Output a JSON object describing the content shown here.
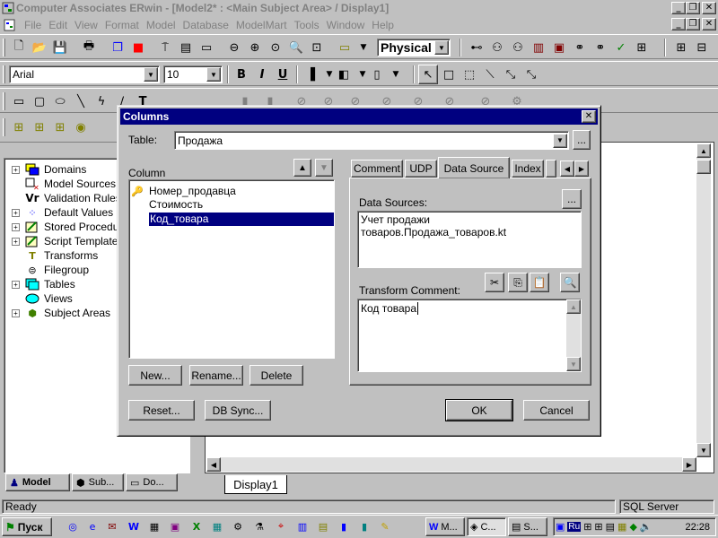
{
  "app": {
    "title": "Computer Associates ERwin - [Model2* : <Main Subject Area> / Display1]",
    "window_buttons": [
      "_",
      "❐",
      "✕"
    ],
    "child_buttons": [
      "_",
      "❐",
      "✕"
    ]
  },
  "menu": [
    "File",
    "Edit",
    "View",
    "Format",
    "Model",
    "Database",
    "ModelMart",
    "Tools",
    "Window",
    "Help"
  ],
  "toolbar": {
    "model_view": "Physical",
    "font_name": "Arial",
    "font_size": "10",
    "bold": "B",
    "italic": "I",
    "underline": "U"
  },
  "tree": [
    {
      "label": "Domains",
      "icon": "domains-icon"
    },
    {
      "label": "Model Sources",
      "icon": "model-sources-icon"
    },
    {
      "label": "Validation Rules",
      "icon": "validation-rules-icon"
    },
    {
      "label": "Default Values",
      "icon": "default-values-icon"
    },
    {
      "label": "Stored Procedures",
      "icon": "stored-procedures-icon"
    },
    {
      "label": "Script Templates",
      "icon": "script-templates-icon"
    },
    {
      "label": "Transforms",
      "icon": "transforms-icon"
    },
    {
      "label": "Filegroup",
      "icon": "filegroup-icon"
    },
    {
      "label": "Tables",
      "icon": "tables-icon"
    },
    {
      "label": "Views",
      "icon": "views-icon"
    },
    {
      "label": "Subject Areas",
      "icon": "subject-areas-icon"
    }
  ],
  "bottom_tabs": [
    "Model",
    "Sub...",
    "Do..."
  ],
  "display_tab": "Display1",
  "dialog": {
    "title": "Columns",
    "table_label": "Table:",
    "table_value": "Продажа",
    "ellipsis": "...",
    "column_label": "Column",
    "columns": [
      "Номер_продавца",
      "Стоимость",
      "Код_товара"
    ],
    "selected_index": 2,
    "tabs": [
      "Comment",
      "UDP",
      "Data Source",
      "Index"
    ],
    "active_tab": "Data Source",
    "data_sources_label": "Data Sources:",
    "data_sources_value": "Учет продажи товаров.Продажа_товаров.kt",
    "transform_comment_label": "Transform Comment:",
    "transform_comment_value": "Код товара",
    "buttons": {
      "new": "New...",
      "rename": "Rename...",
      "delete": "Delete",
      "reset": "Reset...",
      "db_sync": "DB Sync...",
      "ok": "OK",
      "cancel": "Cancel"
    }
  },
  "status": {
    "text": "Ready",
    "db": "SQL Server"
  },
  "taskbar": {
    "start": "Пуск",
    "tasks": [
      "M...",
      "C...",
      "S..."
    ],
    "lang": "Ru",
    "time": "22:28"
  },
  "colors": {
    "face": "#c0c0c0",
    "title_active": "#000080",
    "selection": "#000080"
  }
}
